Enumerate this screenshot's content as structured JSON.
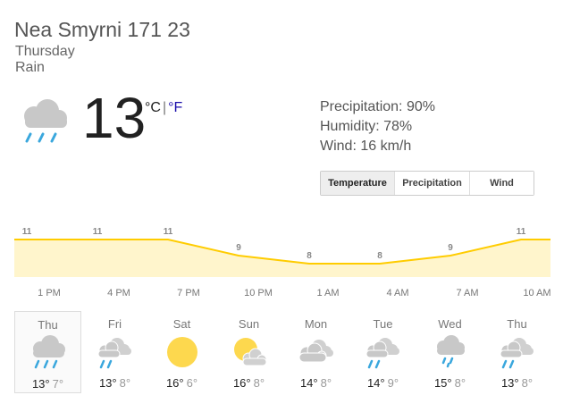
{
  "location": "Nea Smyrni 171 23",
  "day": "Thursday",
  "condition": "Rain",
  "current": {
    "temp": "13",
    "unit_c": "°C",
    "unit_sep": "|",
    "unit_f": "°F",
    "icon": "rain-cloud-icon"
  },
  "details": {
    "precipitation": "Precipitation: 90%",
    "humidity": "Humidity: 78%",
    "wind": "Wind: 16 km/h"
  },
  "tabs": [
    {
      "label": "Temperature",
      "selected": true
    },
    {
      "label": "Precipitation",
      "selected": false
    },
    {
      "label": "Wind",
      "selected": false
    }
  ],
  "chart_data": {
    "type": "area",
    "x": [
      "1 PM",
      "4 PM",
      "7 PM",
      "10 PM",
      "1 AM",
      "4 AM",
      "7 AM",
      "10 AM"
    ],
    "values": [
      11,
      11,
      11,
      9,
      8,
      8,
      9,
      11
    ],
    "labels": [
      "11",
      "11",
      "11",
      "9",
      "8",
      "8",
      "9",
      "11"
    ],
    "fill_color": "#fff5cc",
    "line_color": "#ffcc00"
  },
  "forecast": [
    {
      "day": "Thu",
      "icon": "rain-icon",
      "hi": "13°",
      "lo": "7°",
      "selected": true
    },
    {
      "day": "Fri",
      "icon": "rain-cloud-icon",
      "hi": "13°",
      "lo": "8°"
    },
    {
      "day": "Sat",
      "icon": "sun-icon",
      "hi": "16°",
      "lo": "6°"
    },
    {
      "day": "Sun",
      "icon": "partly-cloudy-icon",
      "hi": "16°",
      "lo": "8°"
    },
    {
      "day": "Mon",
      "icon": "cloud-icon",
      "hi": "14°",
      "lo": "8°"
    },
    {
      "day": "Tue",
      "icon": "rain-cloud-icon",
      "hi": "14°",
      "lo": "9°"
    },
    {
      "day": "Wed",
      "icon": "showers-icon",
      "hi": "15°",
      "lo": "8°"
    },
    {
      "day": "Thu",
      "icon": "rain-cloud-icon",
      "hi": "13°",
      "lo": "8°"
    }
  ]
}
